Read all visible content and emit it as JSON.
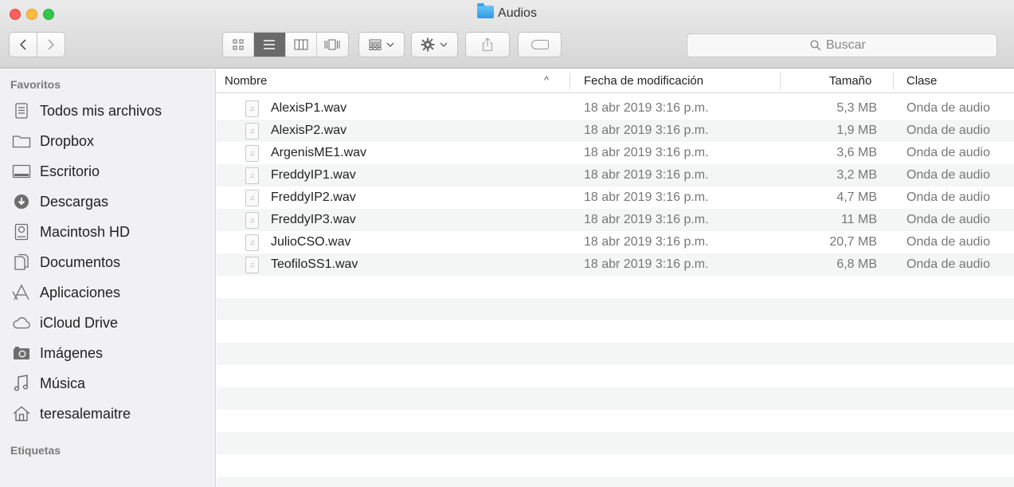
{
  "window": {
    "title": "Audios",
    "colors": {
      "close": "#fc605c",
      "minimize": "#fdbc40",
      "maximize": "#34c84a",
      "folder": "#2a9be6"
    }
  },
  "toolbar": {
    "back_icon": "chevron-left-icon",
    "forward_icon": "chevron-right-icon",
    "view_modes": [
      {
        "name": "icon-view-icon",
        "active": false
      },
      {
        "name": "list-view-icon",
        "active": true
      },
      {
        "name": "column-view-icon",
        "active": false
      },
      {
        "name": "cover-flow-icon",
        "active": false
      }
    ],
    "search_placeholder": "Buscar"
  },
  "sidebar": {
    "favorites_heading": "Favoritos",
    "items": [
      {
        "label": "Todos mis archivos",
        "icon": "all-files-icon"
      },
      {
        "label": "Dropbox",
        "icon": "folder-icon"
      },
      {
        "label": "Escritorio",
        "icon": "desktop-icon"
      },
      {
        "label": "Descargas",
        "icon": "downloads-icon"
      },
      {
        "label": "Macintosh HD",
        "icon": "hard-drive-icon"
      },
      {
        "label": "Documentos",
        "icon": "documents-icon"
      },
      {
        "label": "Aplicaciones",
        "icon": "applications-icon"
      },
      {
        "label": "iCloud Drive",
        "icon": "cloud-icon"
      },
      {
        "label": "Imágenes",
        "icon": "camera-icon"
      },
      {
        "label": "Música",
        "icon": "music-note-icon"
      },
      {
        "label": "teresalemaitre",
        "icon": "home-icon"
      }
    ],
    "tags_heading": "Etiquetas"
  },
  "list": {
    "columns": {
      "name": "Nombre",
      "modified": "Fecha de modificación",
      "size": "Tamaño",
      "kind": "Clase"
    },
    "sort_indicator": "^",
    "files": [
      {
        "name": "AlexisP1.wav",
        "modified": "18 abr 2019 3:16 p.m.",
        "size": "5,3 MB",
        "kind": "Onda de audio"
      },
      {
        "name": "AlexisP2.wav",
        "modified": "18 abr 2019 3:16 p.m.",
        "size": "1,9 MB",
        "kind": "Onda de audio"
      },
      {
        "name": "ArgenisME1.wav",
        "modified": "18 abr 2019 3:16 p.m.",
        "size": "3,6 MB",
        "kind": "Onda de audio"
      },
      {
        "name": "FreddyIP1.wav",
        "modified": "18 abr 2019 3:16 p.m.",
        "size": "3,2 MB",
        "kind": "Onda de audio"
      },
      {
        "name": "FreddyIP2.wav",
        "modified": "18 abr 2019 3:16 p.m.",
        "size": "4,7 MB",
        "kind": "Onda de audio"
      },
      {
        "name": "FreddyIP3.wav",
        "modified": "18 abr 2019 3:16 p.m.",
        "size": "11 MB",
        "kind": "Onda de audio"
      },
      {
        "name": "JulioCSO.wav",
        "modified": "18 abr 2019 3:16 p.m.",
        "size": "20,7 MB",
        "kind": "Onda de audio"
      },
      {
        "name": "TeofiloSS1.wav",
        "modified": "18 abr 2019 3:16 p.m.",
        "size": "6,8 MB",
        "kind": "Onda de audio"
      }
    ]
  }
}
